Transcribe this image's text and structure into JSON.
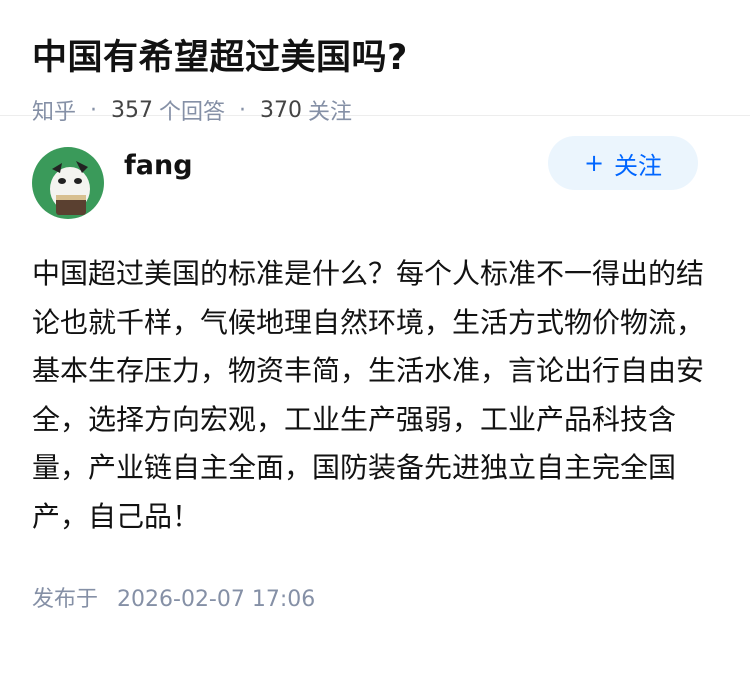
{
  "question": {
    "title": "中国有希望超过美国吗?",
    "source": "知乎",
    "answers_count": "357",
    "answers_label": "个回答",
    "followers_count": "370",
    "followers_label": "关注"
  },
  "author": {
    "name": "fang",
    "avatar_icon": "avatar-cartoon-icon",
    "follow_label": "关注"
  },
  "answer": {
    "content": "中国超过美国的标准是什么？每个人标准不一得出的结论也就千样，气候地理自然环境，生活方式物价物流，基本生存压力，物资丰简，生活水准，言论出行自由安全，选择方向宏观，工业生产强弱，工业产品科技含量，产业链自主全面，国防装备先进独立自主完全国产，自己品！",
    "published_label": "发布于",
    "published_at": "2026-02-07 17:06"
  },
  "colors": {
    "accent": "#0066ff",
    "meta": "#8590a6",
    "avatar_bg": "#3a9a5a"
  }
}
